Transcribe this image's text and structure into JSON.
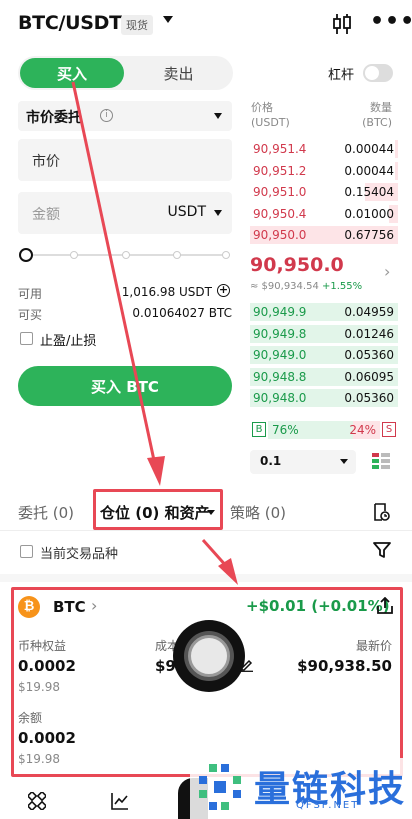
{
  "header": {
    "pair": "BTC/USDT",
    "badge": "现货"
  },
  "trade_form": {
    "buy_tab": "买入",
    "sell_tab": "卖出",
    "leverage_label": "杠杆",
    "order_type": "市价委托",
    "info_glyph": "i",
    "price_placeholder": "市价",
    "amount_placeholder": "金额",
    "amount_unit": "USDT",
    "available_label": "可用",
    "available_value": "1,016.98 USDT",
    "buyable_label": "可买",
    "buyable_value": "0.01064027 BTC",
    "tpsl_label": "止盈/止损",
    "buy_button": "买入 BTC",
    "slider_fraction": 0
  },
  "orderbook": {
    "price_header": "价格",
    "price_unit": "(USDT)",
    "qty_header": "数量",
    "qty_unit": "(BTC)",
    "asks": [
      {
        "price": "90,951.4",
        "qty": "0.00044",
        "depth": 0.02
      },
      {
        "price": "90,951.2",
        "qty": "0.00044",
        "depth": 0.02
      },
      {
        "price": "90,951.0",
        "qty": "0.15404",
        "depth": 0.22
      },
      {
        "price": "90,950.4",
        "qty": "0.01000",
        "depth": 0.06
      },
      {
        "price": "90,950.0",
        "qty": "0.67756",
        "depth": 1.0
      }
    ],
    "mid_price": "90,950.0",
    "mid_ref": "≈ $90,934.54",
    "mid_change": "+1.55%",
    "bids": [
      {
        "price": "90,949.9",
        "qty": "0.04959",
        "depth": 1.0
      },
      {
        "price": "90,949.8",
        "qty": "0.01246",
        "depth": 1.0
      },
      {
        "price": "90,949.0",
        "qty": "0.05360",
        "depth": 1.0
      },
      {
        "price": "90,948.8",
        "qty": "0.06095",
        "depth": 1.0
      },
      {
        "price": "90,948.0",
        "qty": "0.05360",
        "depth": 1.0
      }
    ],
    "buy_box": "B",
    "sell_box": "S",
    "buy_ratio": "76%",
    "sell_ratio": "24%",
    "buy_fraction": 0.76,
    "precision": "0.1"
  },
  "tabs": {
    "orders": "委托 (0)",
    "positions": "仓位 (0) 和资产",
    "strategy": "策略 (0)"
  },
  "filter": {
    "current_only": "当前交易品种"
  },
  "position": {
    "coin": "BTC",
    "coin_glyph": "₿",
    "pnl": "+$0.01 (+0.01%)",
    "equity_label": "币种权益",
    "equity_value": "0.0002",
    "equity_usd": "$19.98",
    "cost_label": "成本",
    "cost_value": "$9",
    "last_label": "最新价",
    "last_value": "$90,938.50",
    "balance_label": "余额",
    "balance_value": "0.0002",
    "balance_usd": "$19.98"
  },
  "watermark": {
    "title": "量链科技",
    "sub": "QFSP.NET"
  },
  "colors": {
    "buy_green": "#2db35a",
    "ask_red": "#d1394c",
    "annotation_red": "#e84855",
    "watermark_blue": "#2a6fdb"
  }
}
